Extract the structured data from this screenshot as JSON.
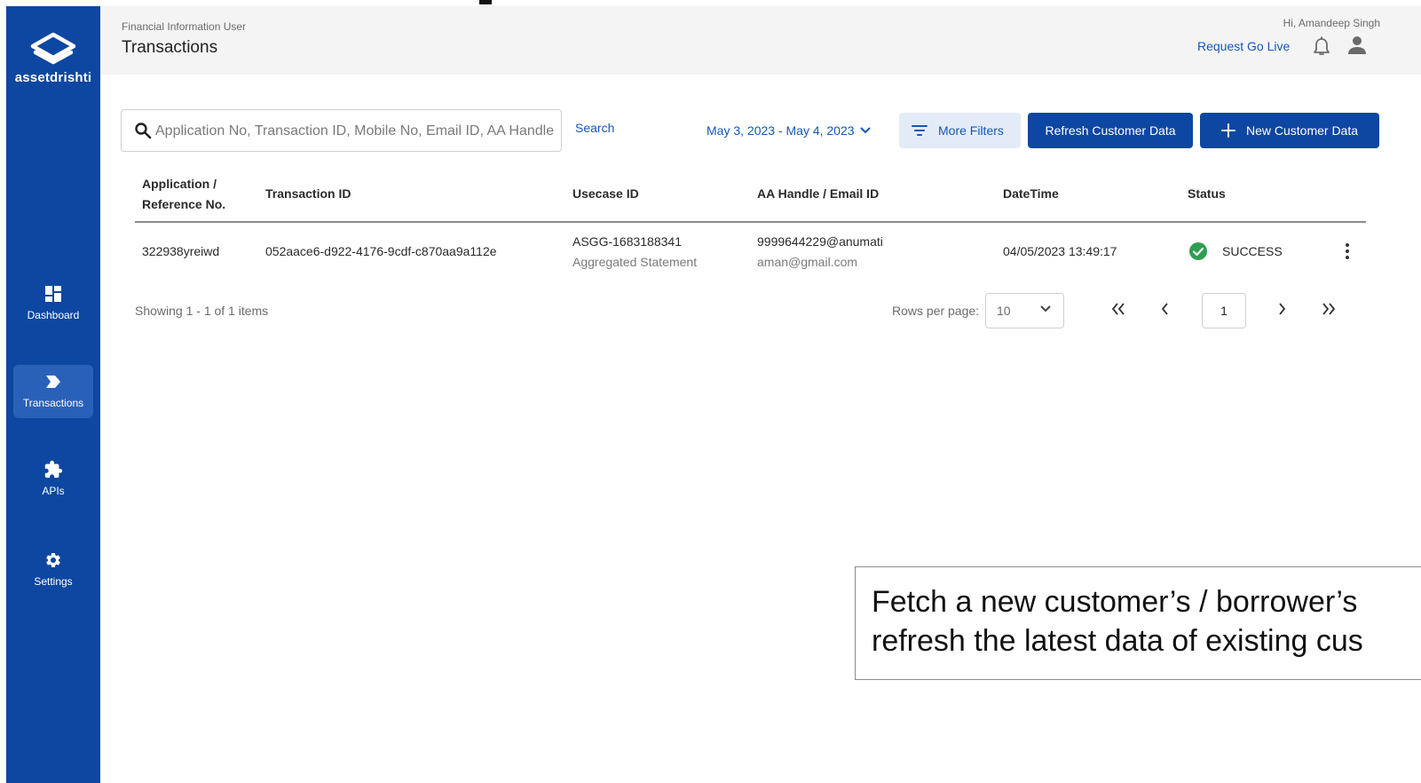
{
  "sidebar": {
    "brand": "assetdrishti",
    "items": [
      {
        "label": "Dashboard",
        "icon": "dashboard-icon"
      },
      {
        "label": "Transactions",
        "icon": "transactions-icon",
        "active": true
      },
      {
        "label": "APIs",
        "icon": "puzzle-icon"
      },
      {
        "label": "Settings",
        "icon": "gear-icon"
      }
    ]
  },
  "header": {
    "role": "Financial Information User",
    "title": "Transactions",
    "greeting": "Hi, Amandeep Singh",
    "go_live": "Request Go Live"
  },
  "toolbar": {
    "search_placeholder": "Application No, Transaction ID, Mobile No, Email ID, AA Handle",
    "search_label": "Search",
    "date_range": "May 3, 2023 - May 4, 2023",
    "more_filters": "More Filters",
    "refresh": "Refresh Customer Data",
    "new_customer": "New Customer Data"
  },
  "table": {
    "headers": {
      "app_line1": "Application /",
      "app_line2": "Reference No.",
      "txn": "Transaction ID",
      "usecase": "Usecase ID",
      "handle": "AA Handle / Email ID",
      "datetime": "DateTime",
      "status": "Status"
    },
    "rows": [
      {
        "app_no": "322938yreiwd",
        "txn_id": "052aace6-d922-4176-9cdf-c870aa9a112e",
        "usecase_id": "ASGG-1683188341",
        "usecase_name": "Aggregated Statement",
        "aa_handle": "9999644229@anumati",
        "email": "aman@gmail.com",
        "datetime": "04/05/2023 13:49:17",
        "status": "SUCCESS"
      }
    ]
  },
  "pagination": {
    "showing": "Showing 1 - 1 of 1 items",
    "rows_per_page_label": "Rows per page:",
    "rows_per_page": "10",
    "current_page": "1"
  },
  "callout": {
    "line1": "Fetch a new customer’s / borrower’s",
    "line2": "refresh the latest data of existing cus"
  },
  "colors": {
    "brand": "#0d47a1",
    "link": "#1557b5",
    "success": "#2e9e4f"
  }
}
